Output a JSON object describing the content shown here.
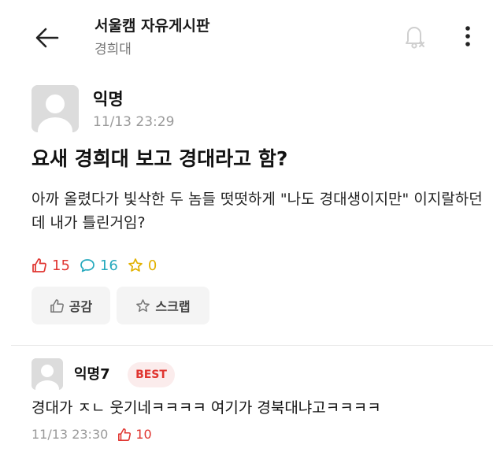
{
  "header": {
    "board_title": "서울캠 자유게시판",
    "board_subtitle": "경희대",
    "icons": {
      "back": "back-arrow-icon",
      "notify": "bell-off-icon",
      "more": "more-vertical-icon"
    }
  },
  "post": {
    "author": "익명",
    "time": "11/13 23:29",
    "title": "요새 경희대 보고 경대라고 함?",
    "body": "아까 올렸다가 빛삭한 두 놈들 떳떳하게 \"나도 경대생이지만\" 이지랄하던데 내가 틀린거임?",
    "stats": {
      "likes": "15",
      "comments": "16",
      "scraps": "0"
    },
    "actions": {
      "like_label": "공감",
      "scrap_label": "스크랩"
    }
  },
  "comments": [
    {
      "author": "익명7",
      "badge": "BEST",
      "text": "경대가 ㅈㄴ 웃기네ㅋㅋㅋㅋ 여기가 경북대냐고ㅋㅋㅋㅋ",
      "time": "11/13 23:30",
      "likes": "10"
    }
  ],
  "colors": {
    "like": "#e03530",
    "comment": "#25a9bd",
    "scrap": "#e2b100",
    "badge_bg": "#fbecec"
  }
}
